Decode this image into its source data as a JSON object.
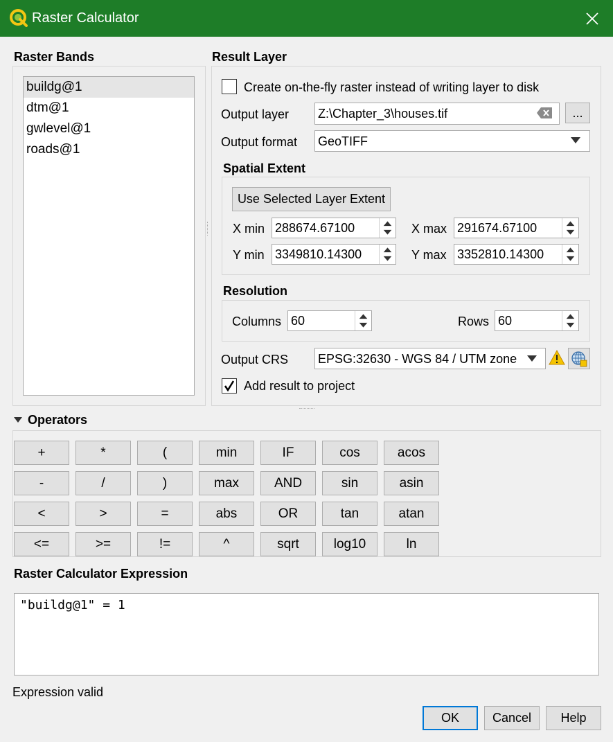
{
  "window": {
    "title": "Raster Calculator",
    "close_icon": "close-icon",
    "app_icon": "qgis-logo-icon"
  },
  "bands": {
    "heading": "Raster Bands",
    "items": [
      {
        "label": "buildg@1",
        "selected": true
      },
      {
        "label": "dtm@1"
      },
      {
        "label": "gwlevel@1"
      },
      {
        "label": "roads@1"
      }
    ]
  },
  "result": {
    "heading": "Result Layer",
    "onthefly_label": "Create on-the-fly raster instead of writing layer to disk",
    "onthefly_checked": false,
    "output_layer_label": "Output layer",
    "output_layer_value": "Z:\\Chapter_3\\houses.tif",
    "browse_label": "...",
    "output_format_label": "Output format",
    "output_format_value": "GeoTIFF",
    "spatial_extent": {
      "heading": "Spatial Extent",
      "use_selected_label": "Use Selected Layer Extent",
      "xmin_label": "X min",
      "xmin_value": "288674.67100",
      "xmax_label": "X max",
      "xmax_value": "291674.67100",
      "ymin_label": "Y min",
      "ymin_value": "3349810.14300",
      "ymax_label": "Y max",
      "ymax_value": "3352810.14300"
    },
    "resolution": {
      "heading": "Resolution",
      "columns_label": "Columns",
      "columns_value": "60",
      "rows_label": "Rows",
      "rows_value": "60"
    },
    "crs_label": "Output CRS",
    "crs_value": "EPSG:32630 - WGS 84 / UTM zone",
    "add_result_label": "Add result to project",
    "add_result_checked": true
  },
  "operators": {
    "heading": "Operators",
    "rows": [
      [
        "+",
        "*",
        "(",
        "min",
        "IF",
        "cos",
        "acos"
      ],
      [
        "-",
        "/",
        ")",
        "max",
        "AND",
        "sin",
        "asin"
      ],
      [
        "<",
        ">",
        "=",
        "abs",
        "OR",
        "tan",
        "atan"
      ],
      [
        "<=",
        ">=",
        "!=",
        "^",
        "sqrt",
        "log10",
        "ln"
      ]
    ]
  },
  "expression": {
    "heading": "Raster Calculator Expression",
    "value": "\"buildg@1\" = 1",
    "status": "Expression valid"
  },
  "buttons": {
    "ok": "OK",
    "cancel": "Cancel",
    "help": "Help"
  },
  "colors": {
    "titlebar": "#1e7d28",
    "accent_focus": "#0078d7",
    "warning": "#f5c400"
  }
}
